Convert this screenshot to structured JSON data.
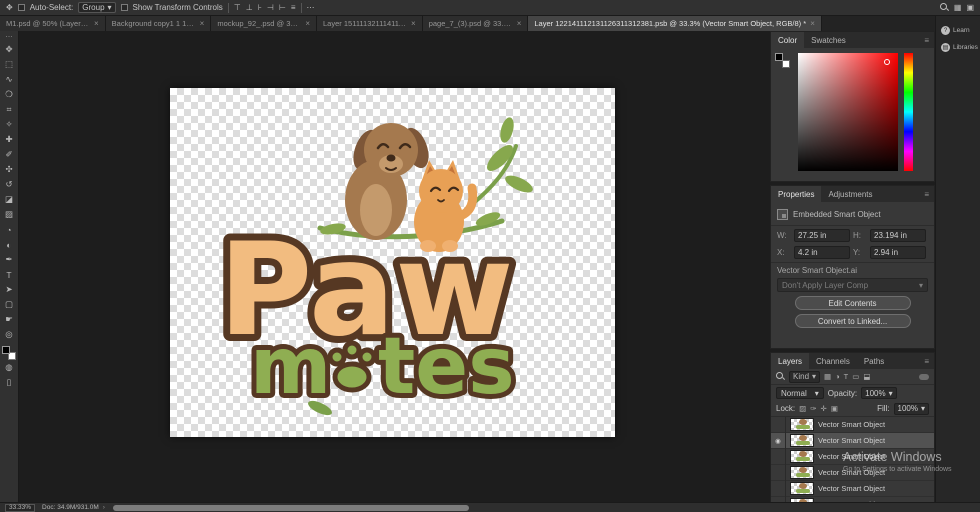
{
  "options_bar": {
    "move_tool_glyph": "✥",
    "auto_select_label": "Auto-Select:",
    "group_value": "Group",
    "dropdown_arrow": "▾",
    "show_transform_label": "Show Transform Controls",
    "align_icons": [
      "⊤",
      "⊥",
      "⊦",
      "⊣",
      "⊢",
      "≡"
    ],
    "more_glyph": "⋯",
    "workspace_icon_glyph": "▦",
    "grid_icon_glyph": "▣"
  },
  "tabs": {
    "close_glyph": "×",
    "items": [
      {
        "title": "M1.psd @ 50% (Layer 5, R..."
      },
      {
        "title": "Background copy1 1 1 1 4.psb"
      },
      {
        "title": "mockup_92_.psd @ 36.7% (L..."
      },
      {
        "title": "Layer 15111132111411152.psb..."
      },
      {
        "title": "page_7_(3).psd @ 33.3% (Lay..."
      },
      {
        "title": "Layer 122141112131126311312381.psb @ 33.3% (Vector Smart Object, RGB/8) *"
      }
    ]
  },
  "toolbar": {
    "edit_glyph": "⋯",
    "quick_mask_glyph": "◍",
    "screen_mode_glyph": "▯",
    "tools": [
      {
        "name": "move-tool",
        "glyph": "✥"
      },
      {
        "name": "rectangular-marquee-tool",
        "glyph": "⬚"
      },
      {
        "name": "lasso-tool",
        "glyph": "∿"
      },
      {
        "name": "quick-selection-tool",
        "glyph": "❍"
      },
      {
        "name": "crop-tool",
        "glyph": "⌗"
      },
      {
        "name": "eyedropper-tool",
        "glyph": "✧"
      },
      {
        "name": "healing-brush-tool",
        "glyph": "✚"
      },
      {
        "name": "brush-tool",
        "glyph": "✐"
      },
      {
        "name": "clone-stamp-tool",
        "glyph": "✣"
      },
      {
        "name": "history-brush-tool",
        "glyph": "↺"
      },
      {
        "name": "eraser-tool",
        "glyph": "◪"
      },
      {
        "name": "gradient-tool",
        "glyph": "▨"
      },
      {
        "name": "blur-tool",
        "glyph": "◔"
      },
      {
        "name": "dodge-tool",
        "glyph": "◐"
      },
      {
        "name": "pen-tool",
        "glyph": "✒"
      },
      {
        "name": "type-tool",
        "glyph": "T"
      },
      {
        "name": "path-selection-tool",
        "glyph": "➤"
      },
      {
        "name": "shape-tool",
        "glyph": "▢"
      },
      {
        "name": "hand-tool",
        "glyph": "☛"
      },
      {
        "name": "zoom-tool",
        "glyph": "◎"
      }
    ]
  },
  "canvas": {
    "logo": {
      "word1": "Paw",
      "word2_m": "m",
      "word2_rest": "tes"
    },
    "palette": {
      "tan": "#f2bc80",
      "green": "#8fae52",
      "outline": "#563823",
      "dog_brown": "#a5794e",
      "cat_orange": "#e8a055",
      "leaf_green": "#87a84d"
    }
  },
  "panels": {
    "color": {
      "tabs": [
        "Color",
        "Swatches"
      ],
      "menu_glyph": "≡"
    },
    "properties": {
      "tabs": [
        "Properties",
        "Adjustments"
      ],
      "menu_glyph": "≡",
      "object_type": "Embedded Smart Object",
      "fields": {
        "w_label": "W:",
        "w_value": "27.25 in",
        "h_label": "H:",
        "h_value": "23.194 in",
        "x_label": "X:",
        "x_value": "4.2 in",
        "y_label": "Y:",
        "y_value": "2.94 in"
      },
      "file_name": "Vector Smart Object.ai",
      "layer_comp_value": "Don't Apply Layer Comp",
      "edit_contents_label": "Edit Contents",
      "convert_label": "Convert to Linked..."
    },
    "layers": {
      "tabs": [
        "Layers",
        "Channels",
        "Paths"
      ],
      "menu_glyph": "≡",
      "filter_kind_label": "Kind",
      "filter_icons": [
        "▦",
        "◑",
        "T",
        "▭",
        "⬓"
      ],
      "blend_mode_value": "Normal",
      "opacity_label": "Opacity:",
      "opacity_value": "100%",
      "lock_label": "Lock:",
      "lock_icons": [
        "▨",
        "✑",
        "✛",
        "▣"
      ],
      "fill_label": "Fill:",
      "fill_value": "100%",
      "eye_glyph": "◉",
      "rows": [
        {
          "name": "Vector Smart Object"
        },
        {
          "name": "Vector Smart Object"
        },
        {
          "name": "Vector Smart Object"
        },
        {
          "name": "Vector Smart Object"
        },
        {
          "name": "Vector Smart Object"
        },
        {
          "name": "Vector Smart Object"
        }
      ]
    }
  },
  "right_rail": {
    "items": [
      {
        "label": "Learn",
        "glyph": "?"
      },
      {
        "label": "Libraries",
        "glyph": "▤"
      }
    ]
  },
  "status_bar": {
    "zoom": "33.33%",
    "doc": "Doc: 34.9M/931.0M",
    "caret": "›"
  },
  "watermark": {
    "line1": "Activate Windows",
    "line2": "Go to Settings to activate Windows"
  }
}
